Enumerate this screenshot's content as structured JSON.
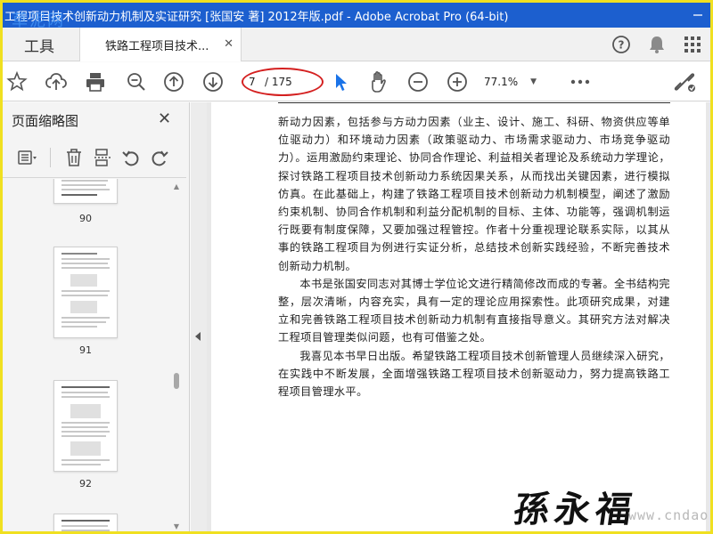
{
  "window": {
    "title": "工程项目技术创新动力机制及实证研究 [张国安 著] 2012年版.pdf - Adobe Acrobat Pro (64-bit)",
    "logo_overlay": "草泥网"
  },
  "tabs": {
    "tools_label": "工具",
    "doc_tab_label": "铁路工程项目技术..."
  },
  "toolbar": {
    "current_page": "7",
    "total_pages": "/ 175",
    "zoom": "77.1%"
  },
  "left_panel": {
    "title": "页面缩略图",
    "thumbnails": [
      {
        "label": "90"
      },
      {
        "label": "91"
      },
      {
        "label": "92"
      }
    ]
  },
  "document": {
    "paragraphs": [
      {
        "indent": false,
        "text": "新动力因素，包括参与方动力因素（业主、设计、施工、科研、物资供应等单位驱动力）和环境动力因素（政策驱动力、市场需求驱动力、市场竞争驱动力）。运用激励约束理论、协同合作理论、利益相关者理论及系统动力学理论，探讨铁路工程项目技术创新动力系统因果关系，从而找出关键因素，进行模拟仿真。在此基础上，构建了铁路工程项目技术创新动力机制模型，阐述了激励约束机制、协同合作机制和利益分配机制的目标、主体、功能等，强调机制运行既要有制度保障，又要加强过程管控。作者十分重视理论联系实际，以其从事的铁路工程项目为例进行实证分析，总结技术创新实践经验，不断完善技术创新动力机制。"
      },
      {
        "indent": true,
        "text": "本书是张国安同志对其博士学位论文进行精简修改而成的专著。全书结构完整，层次清晰，内容充实，具有一定的理论应用探索性。此项研究成果，对建立和完善铁路工程项目技术创新动力机制有直接指导意义。其研究方法对解决工程项目管理类似问题，也有可借鉴之处。"
      },
      {
        "indent": true,
        "text": "我喜见本书早日出版。希望铁路工程项目技术创新管理人员继续深入研究，在实践中不断发展，全面增强铁路工程项目技术创新驱动力，努力提高铁路工程项目管理水平。"
      }
    ],
    "signature": "孫永福",
    "watermark": "www.cndao.com"
  },
  "colors": {
    "titlebar": "#1c5fcf",
    "highlight_ellipse": "#d42020",
    "frame_border": "#f0e020",
    "select_tool_blue": "#1a73e8"
  }
}
